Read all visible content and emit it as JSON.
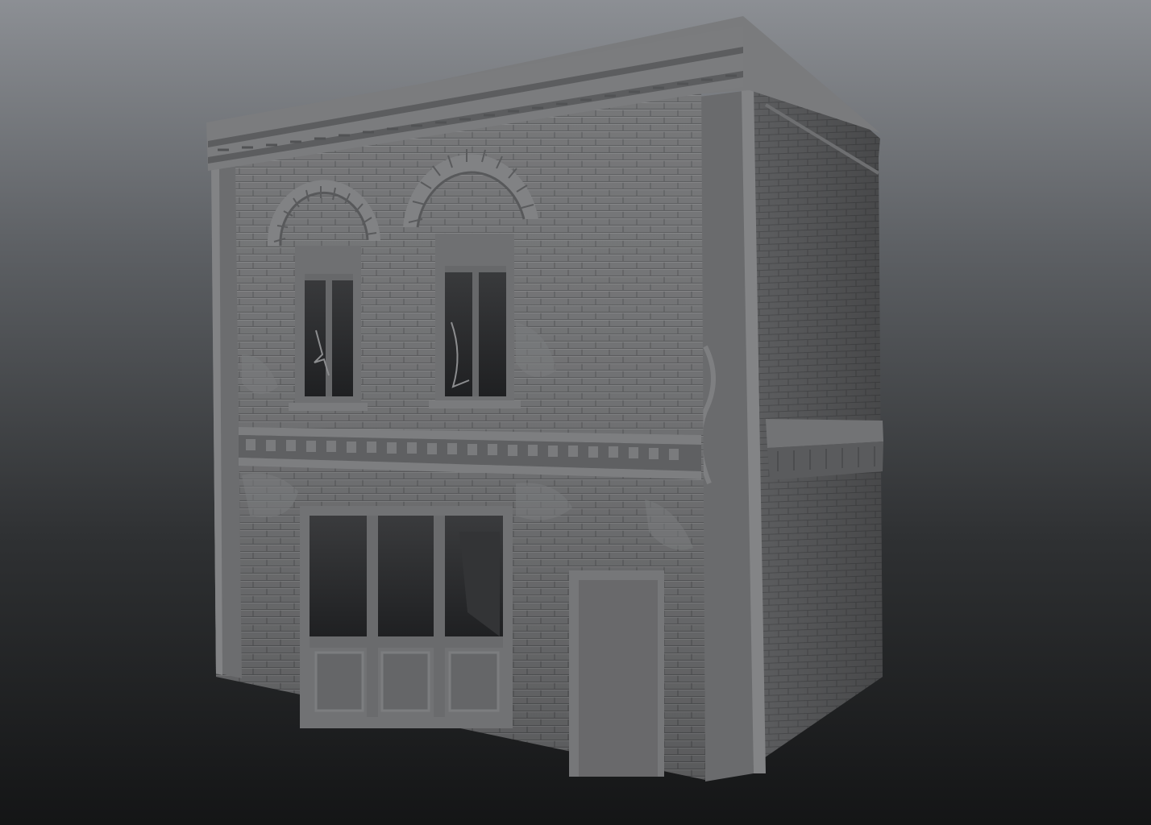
{
  "scene": {
    "subject": "building-sculpt",
    "background_top": "#8c8f94",
    "background_bottom": "#141516",
    "front_color": "#6d6e70",
    "side_color": "#5e5f61",
    "roof_color": "#77787a",
    "trim_color": "#7c7d80",
    "brick_line_color": "#545557",
    "glass_color": "#2a2b2d",
    "frame_color": "#67686a"
  }
}
